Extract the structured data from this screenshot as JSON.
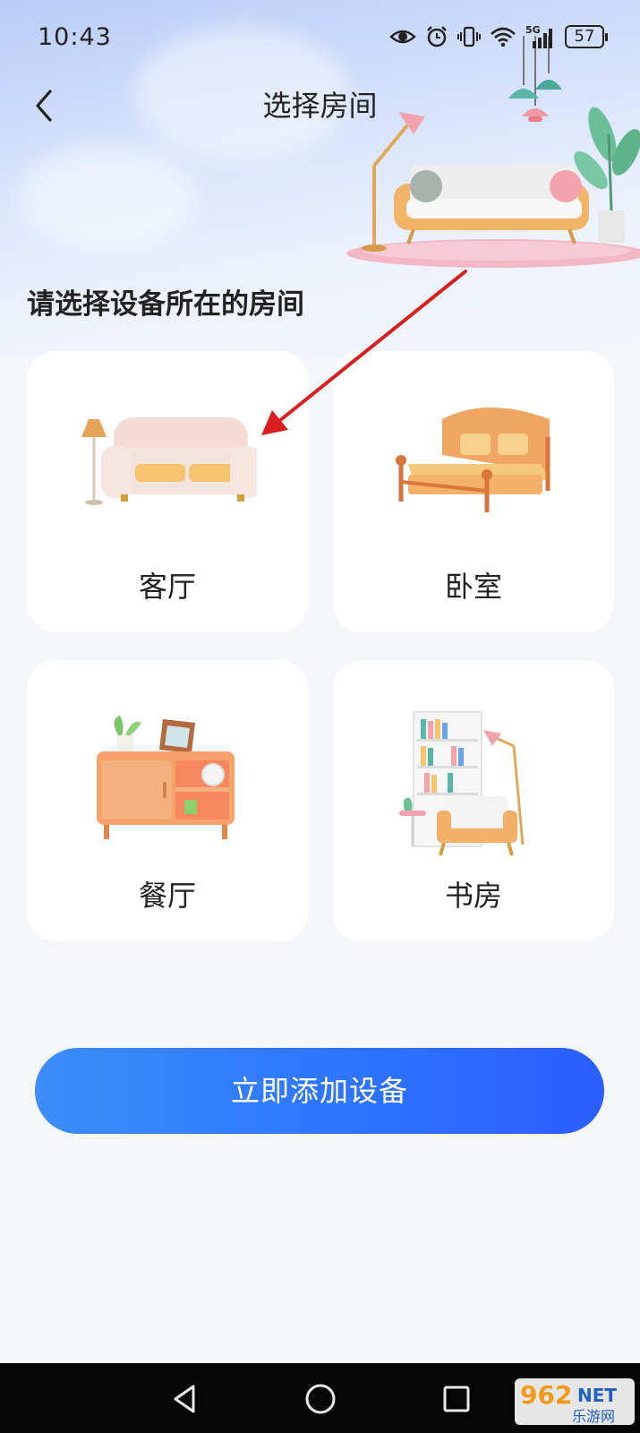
{
  "status_bar": {
    "time": "10:43",
    "battery": "57"
  },
  "header": {
    "title": "选择房间"
  },
  "prompt": "请选择设备所在的房间",
  "rooms": [
    {
      "label": "客厅",
      "icon": "sofa-icon"
    },
    {
      "label": "卧室",
      "icon": "bed-icon"
    },
    {
      "label": "餐厅",
      "icon": "cabinet-icon"
    },
    {
      "label": "书房",
      "icon": "bookshelf-chair-icon"
    }
  ],
  "add_button": {
    "label": "立即添加设备"
  },
  "nav_bar": {
    "back": "triangle-back-icon",
    "home": "circle-home-icon",
    "recents": "square-recents-icon"
  },
  "watermark": {
    "top": "962",
    "suffix": "NET",
    "bottom": "乐游网"
  },
  "colors": {
    "accent": "#2d74ff",
    "arrow": "#d81e1e"
  }
}
